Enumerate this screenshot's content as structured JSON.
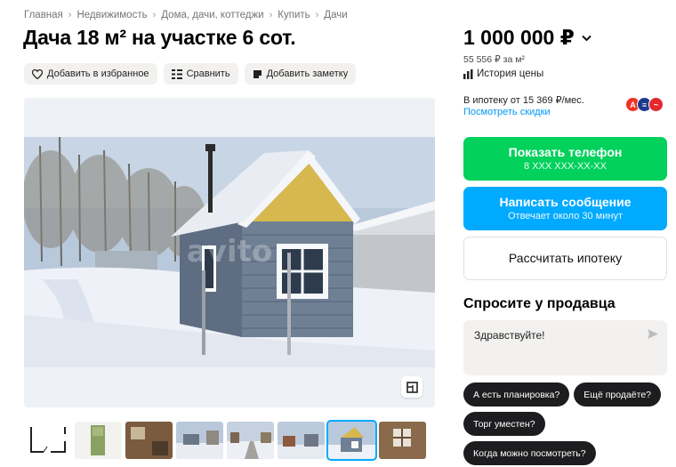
{
  "breadcrumbs": [
    "Главная",
    "Недвижимость",
    "Дома, дачи, коттеджи",
    "Купить",
    "Дачи"
  ],
  "title": "Дача 18 м² на участке 6 сот.",
  "actions": {
    "favorite": "Добавить в избранное",
    "compare": "Сравнить",
    "note": "Добавить заметку"
  },
  "price": {
    "value": "1 000 000 ₽",
    "per_meter": "55 556 ₽ за м²",
    "history": "История цены"
  },
  "mortgage": {
    "text": "В ипотеку от 15 369 ₽/мес.",
    "discounts": "Посмотреть скидки"
  },
  "contact": {
    "phone_label": "Показать телефон",
    "phone_mask": "8 XXX XXX-XX-XX",
    "message_label": "Написать сообщение",
    "message_sub": "Отвечает около 30 минут",
    "calc_label": "Рассчитать ипотеку"
  },
  "ask": {
    "title": "Спросите у продавца",
    "message": "Здравствуйте!",
    "chips": [
      "А есть планировка?",
      "Ещё продаёте?",
      "Торг уместен?",
      "Когда можно посмотреть?"
    ]
  },
  "gallery": {
    "watermark": "avito",
    "thumbnail_count": 8,
    "active_index": 6
  },
  "colors": {
    "green": "#02d15c",
    "blue": "#00aaff",
    "link": "#0099f7"
  }
}
